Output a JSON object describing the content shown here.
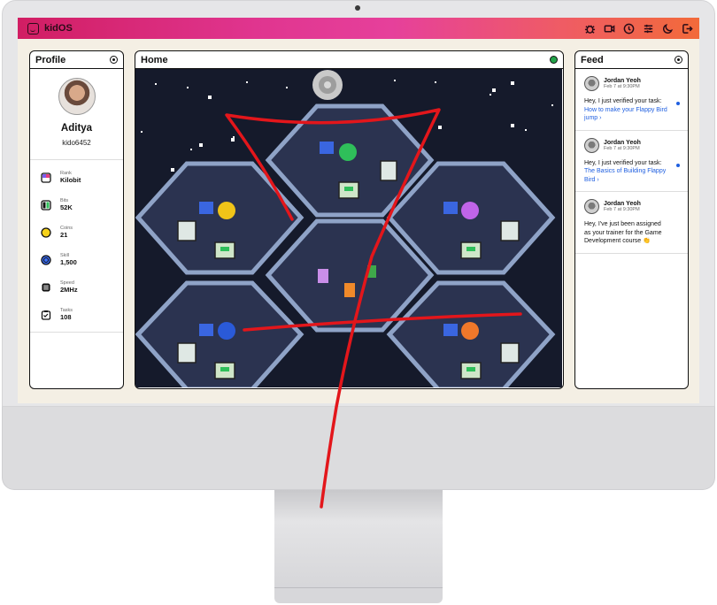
{
  "os": {
    "brand": "kidOS"
  },
  "topbar_icons": [
    "bug-icon",
    "video-icon",
    "clock-icon",
    "sliders-icon",
    "moon-icon",
    "logout-icon"
  ],
  "profile": {
    "title": "Profile",
    "name": "Aditya",
    "username": "kido6452",
    "stats": [
      {
        "label": "Rank",
        "value": "Kilobit",
        "icon": "rank-icon"
      },
      {
        "label": "Bits",
        "value": "52K",
        "icon": "bits-icon"
      },
      {
        "label": "Coins",
        "value": "21",
        "icon": "coin-icon"
      },
      {
        "label": "Skill",
        "value": "1,500",
        "icon": "skill-icon"
      },
      {
        "label": "Speed",
        "value": "2MHz",
        "icon": "chip-icon"
      },
      {
        "label": "Tasks",
        "value": "108",
        "icon": "tasks-icon"
      }
    ]
  },
  "home": {
    "title": "Home",
    "status_color": "#23a34a"
  },
  "feed": {
    "title": "Feed",
    "items": [
      {
        "author": "Jordan Yeoh",
        "time": "Feb 7 at 9:30PM",
        "text": "Hey, I just verified your task: ",
        "link": "How to make your Flappy Bird jump",
        "arrow": " ›",
        "unread": true
      },
      {
        "author": "Jordan Yeoh",
        "time": "Feb 7 at 9:30PM",
        "text": "Hey, I just verified your task: ",
        "link": "The Basics of Building Flappy Bird",
        "arrow": " ›",
        "unread": true
      },
      {
        "author": "Jordan Yeoh",
        "time": "Feb 7 at 9:30PM",
        "text": "Hey, I've just been assigned as your trainer for the Game Development course 👏",
        "link": "",
        "arrow": "",
        "unread": false
      }
    ]
  },
  "colors": {
    "topbar_start": "#d11e63",
    "topbar_end": "#f26a3a",
    "link": "#1f5fe0",
    "scribble": "#e3161b",
    "game_bg": "#151a2b"
  }
}
